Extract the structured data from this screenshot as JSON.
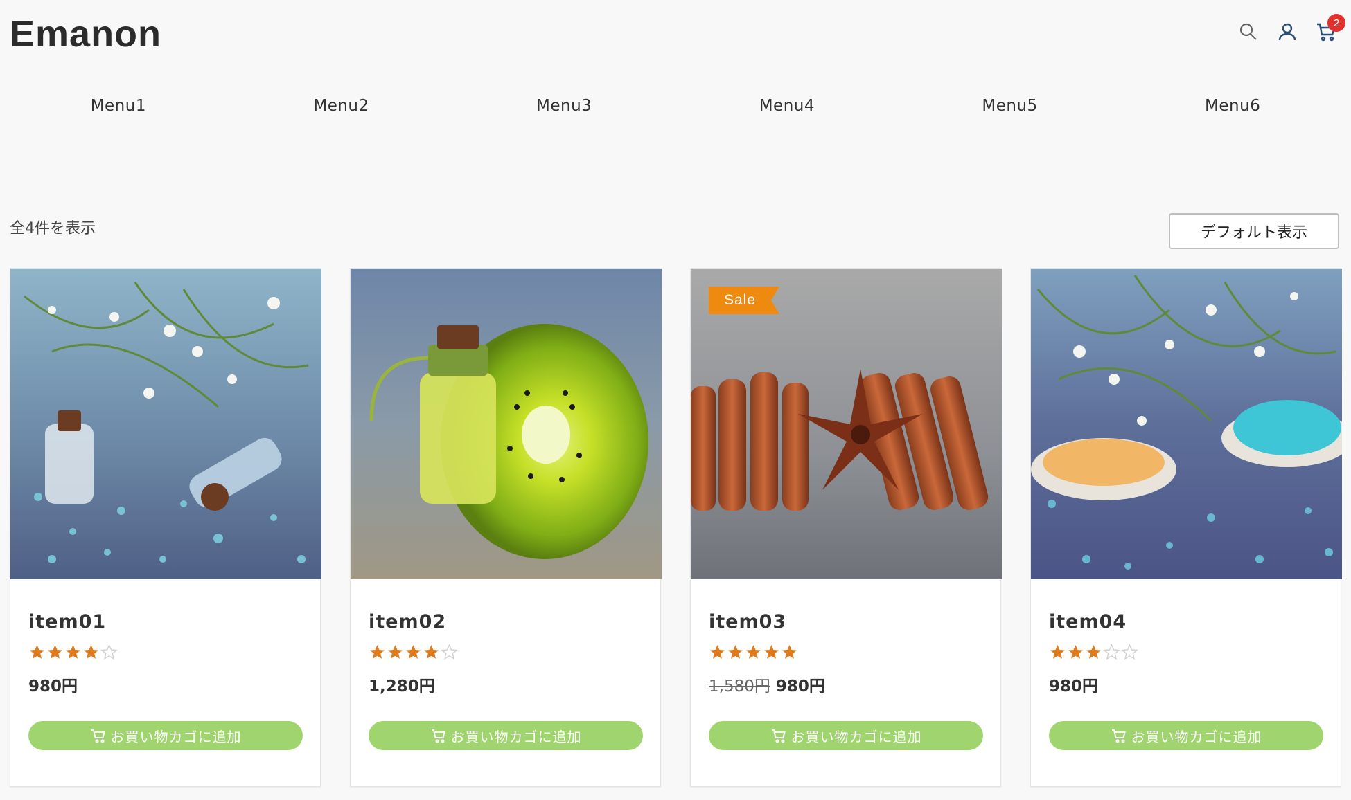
{
  "site": {
    "logo": "Emanon"
  },
  "header": {
    "icons": [
      "search-icon",
      "user-icon",
      "cart-icon"
    ],
    "cart_count": "2"
  },
  "nav": [
    "Menu1",
    "Menu2",
    "Menu3",
    "Menu4",
    "Menu5",
    "Menu6"
  ],
  "shop": {
    "result_count": "全4件を表示",
    "ordering_label": "デフォルト表示"
  },
  "products": [
    {
      "title": "item01",
      "rating": 4,
      "price_old": "",
      "price": "980円",
      "sale": "",
      "button": "お買い物カゴに追加"
    },
    {
      "title": "item02",
      "rating": 4,
      "price_old": "",
      "price": "1,280円",
      "sale": "",
      "button": "お買い物カゴに追加"
    },
    {
      "title": "item03",
      "rating": 5,
      "price_old": "1,580円",
      "price": "980円",
      "sale": "Sale",
      "button": "お買い物カゴに追加"
    },
    {
      "title": "item04",
      "rating": 3,
      "price_old": "",
      "price": "980円",
      "sale": "",
      "button": "お買い物カゴに追加"
    }
  ],
  "colors": {
    "star": "#e07a1f",
    "button": "#a0d46e",
    "sale": "#ef8a10",
    "badge": "#e0312f"
  }
}
